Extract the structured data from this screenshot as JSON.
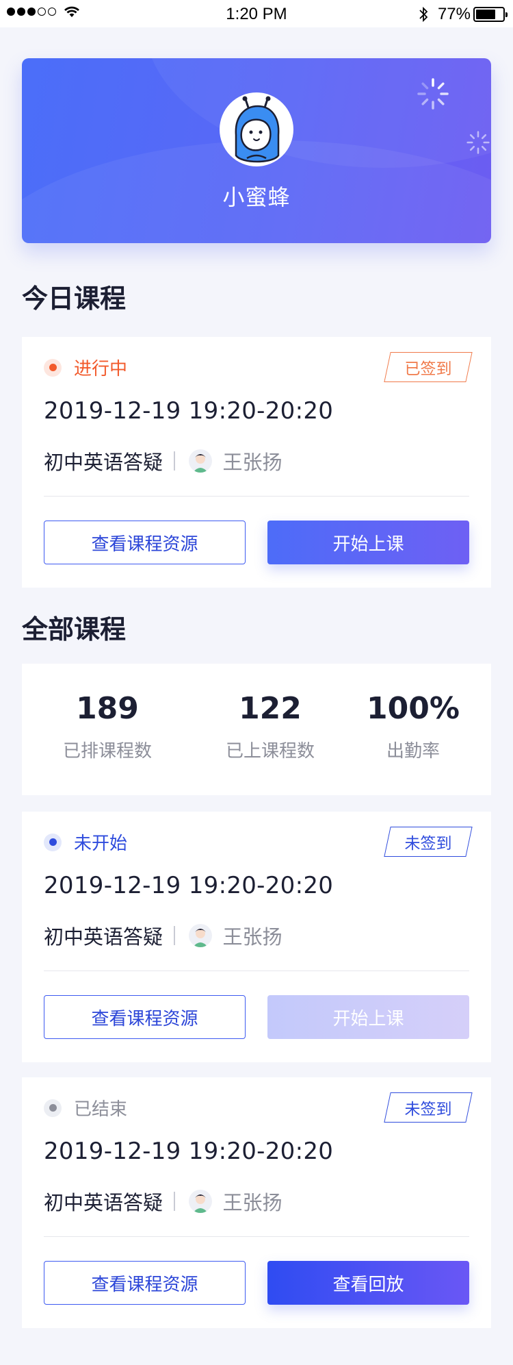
{
  "status_bar": {
    "time": "1:20 PM",
    "battery": "77%",
    "battery_level": 0.77,
    "signal_filled": 3,
    "signal_total": 5
  },
  "profile": {
    "name": "小蜜蜂",
    "avatar_icon": "bee-mascot-icon"
  },
  "today_section": {
    "title": "今日课程"
  },
  "all_section": {
    "title": "全部课程"
  },
  "stats": [
    {
      "value": "189",
      "label": "已排课程数"
    },
    {
      "value": "122",
      "label": "已上课程数"
    },
    {
      "value": "100%",
      "label": "出勤率"
    }
  ],
  "today_course": {
    "status": "进行中",
    "status_color": "#f25a2b",
    "sign_status": "已签到",
    "sign_color": "#f07a4a",
    "time": "2019-12-19 19:20-20:20",
    "course_name": "初中英语答疑",
    "teacher": "王张扬",
    "resource_button": "查看课程资源",
    "action_button": "开始上课"
  },
  "courses": [
    {
      "status": "未开始",
      "status_color": "#2f4cdd",
      "sign_status": "未签到",
      "sign_color": "#2f4cdd",
      "time": "2019-12-19 19:20-20:20",
      "course_name": "初中英语答疑",
      "teacher": "王张扬",
      "resource_button": "查看课程资源",
      "action_button": "开始上课",
      "action_enabled": false
    },
    {
      "status": "已结束",
      "status_color": "#8c8e99",
      "sign_status": "未签到",
      "sign_color": "#2f4cdd",
      "time": "2019-12-19 19:20-20:20",
      "course_name": "初中英语答疑",
      "teacher": "王张扬",
      "resource_button": "查看课程资源",
      "action_button": "查看回放",
      "action_enabled": true
    }
  ],
  "colors": {
    "accent": "#4d6cf8",
    "accent_end": "#6e60f4",
    "background": "#f4f5fb"
  }
}
